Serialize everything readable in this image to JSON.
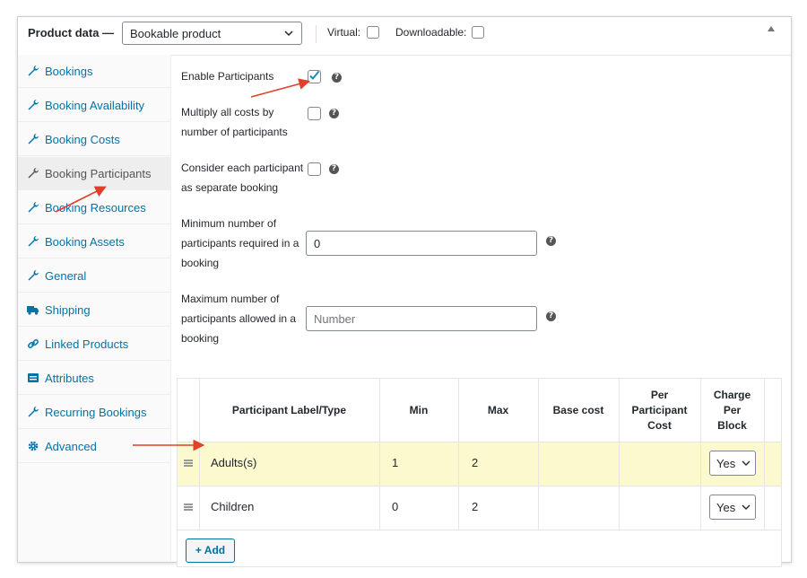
{
  "header": {
    "title": "Product data —",
    "product_type": "Bookable product",
    "virtual_label": "Virtual:",
    "downloadable_label": "Downloadable:"
  },
  "sidebar": {
    "active_index": 3,
    "items": [
      {
        "label": "Bookings",
        "icon": "wrench-icon"
      },
      {
        "label": "Booking Availability",
        "icon": "wrench-icon"
      },
      {
        "label": "Booking Costs",
        "icon": "wrench-icon"
      },
      {
        "label": "Booking Participants",
        "icon": "wrench-icon"
      },
      {
        "label": "Booking Resources",
        "icon": "wrench-icon"
      },
      {
        "label": "Booking Assets",
        "icon": "wrench-icon"
      },
      {
        "label": "General",
        "icon": "wrench-icon"
      },
      {
        "label": "Shipping",
        "icon": "truck-icon"
      },
      {
        "label": "Linked Products",
        "icon": "link-icon"
      },
      {
        "label": "Attributes",
        "icon": "list-icon"
      },
      {
        "label": "Recurring Bookings",
        "icon": "wrench-icon"
      },
      {
        "label": "Advanced",
        "icon": "gear-icon"
      }
    ]
  },
  "fields": {
    "enable_participants": {
      "label": "Enable Participants",
      "checked": true
    },
    "multiply_costs": {
      "line1": "Multiply all costs by",
      "line2": "number of participants",
      "checked": false
    },
    "separate_booking": {
      "line1": "Consider each participant",
      "line2": "as separate booking",
      "checked": false
    },
    "min_participants": {
      "line1": "Minimum number of",
      "line2": "participants required in a",
      "line3": "booking",
      "value": "0"
    },
    "max_participants": {
      "line1": "Maximum number of",
      "line2": "participants allowed in a",
      "line3": "booking",
      "placeholder": "Number"
    }
  },
  "table": {
    "headers": {
      "label": "Participant Label/Type",
      "min": "Min",
      "max": "Max",
      "base_cost": "Base cost",
      "per_participant_1": "Per",
      "per_participant_2": "Participant",
      "per_participant_3": "Cost",
      "charge_1": "Charge",
      "charge_2": "Per",
      "charge_3": "Block"
    },
    "rows": [
      {
        "label": "Adults(s)",
        "min": "1",
        "max": "2",
        "base_cost": "",
        "per_cost": "",
        "charge": "Yes",
        "highlighted": true
      },
      {
        "label": "Children",
        "min": "0",
        "max": "2",
        "base_cost": "",
        "per_cost": "",
        "charge": "Yes",
        "highlighted": false
      }
    ],
    "add_button": "+ Add"
  },
  "colors": {
    "link": "#0073aa",
    "annotation_arrow": "#e0402a",
    "highlight_row": "#fcf9ce",
    "checkmark": "#1e8cbe"
  }
}
